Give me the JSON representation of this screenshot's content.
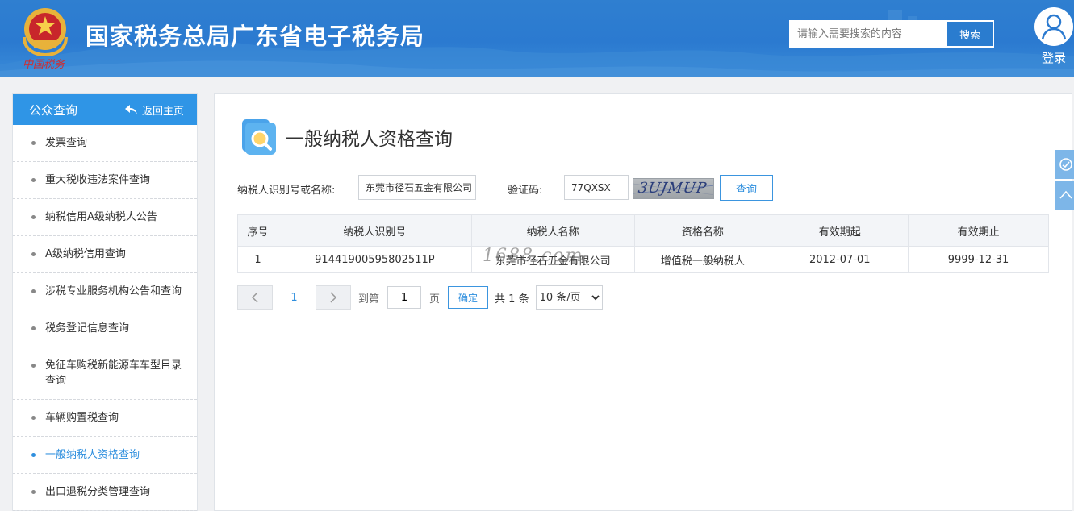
{
  "header": {
    "site_title": "国家税务总局广东省电子税务局",
    "emblem_caption": "中国税务",
    "search": {
      "placeholder": "请输入需要搜索的内容",
      "button_label": "搜索"
    },
    "login_label": "登录"
  },
  "sidebar": {
    "title": "公众查询",
    "back_label": "返回主页",
    "items": [
      {
        "label": "发票查询"
      },
      {
        "label": "重大税收违法案件查询"
      },
      {
        "label": "纳税信用A级纳税人公告"
      },
      {
        "label": "A级纳税信用查询"
      },
      {
        "label": "涉税专业服务机构公告和查询"
      },
      {
        "label": "税务登记信息查询"
      },
      {
        "label": "免征车购税新能源车车型目录查询"
      },
      {
        "label": "车辆购置税查询"
      },
      {
        "label": "一般纳税人资格查询",
        "active": true
      },
      {
        "label": "出口退税分类管理查询"
      }
    ]
  },
  "main": {
    "page_title": "一般纳税人资格查询",
    "form": {
      "taxpayer_label": "纳税人识别号或名称:",
      "taxpayer_value": "东莞市径石五金有限公司",
      "captcha_label": "验证码:",
      "captcha_value": "77QXSX",
      "captcha_image_text": "3UJMUP",
      "query_button": "查询"
    },
    "table": {
      "headers": [
        "序号",
        "纳税人识别号",
        "纳税人名称",
        "资格名称",
        "有效期起",
        "有效期止"
      ],
      "rows": [
        [
          "1",
          "91441900595802511P",
          "东莞市径石五金有限公司",
          "增值税一般纳税人",
          "2012-07-01",
          "9999-12-31"
        ]
      ]
    },
    "pager": {
      "current_page": "1",
      "goto_prefix": "到第",
      "goto_value": "1",
      "goto_suffix": "页",
      "confirm_label": "确定",
      "total_text": "共 1 条",
      "page_size": "10 条/页"
    },
    "watermark": "1688.com"
  },
  "colors": {
    "header_blue": "#2b7ad0",
    "sidebar_head": "#2f95e6",
    "accent": "#2f8fde",
    "float_tool": "#7db6e8"
  }
}
